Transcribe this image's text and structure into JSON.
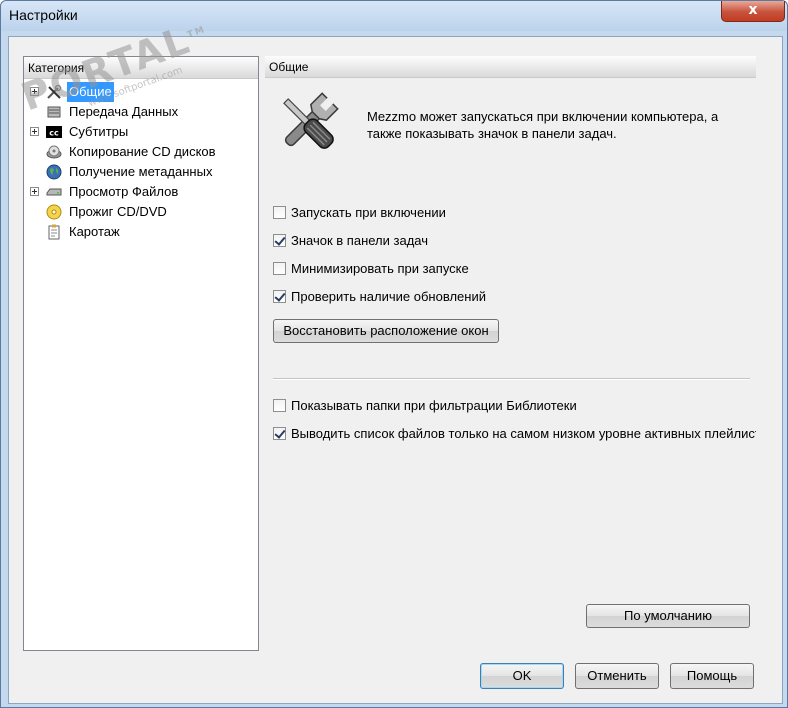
{
  "window": {
    "title": "Настройки",
    "close_glyph": "x"
  },
  "watermark": {
    "big": "PORTAL",
    "tm": "TM",
    "small": "www.softportal.com"
  },
  "category_panel": {
    "header": "Категория",
    "items": [
      {
        "label": "Общие",
        "icon": "tools-icon",
        "expandable": true,
        "selected": true
      },
      {
        "label": "Передача Данных",
        "icon": "server-icon",
        "expandable": false
      },
      {
        "label": "Субтитры",
        "icon": "cc-icon",
        "expandable": true
      },
      {
        "label": "Копирование CD дисков",
        "icon": "cd-drive-icon",
        "expandable": false
      },
      {
        "label": "Получение метаданных",
        "icon": "globe-icon",
        "expandable": false
      },
      {
        "label": "Просмотр Файлов",
        "icon": "drive-icon",
        "expandable": true
      },
      {
        "label": "Прожиг CD/DVD",
        "icon": "disc-icon",
        "expandable": false
      },
      {
        "label": "Каротаж",
        "icon": "log-icon",
        "expandable": false
      }
    ]
  },
  "general_panel": {
    "header": "Общие",
    "icon": "tools-icon",
    "description": "Mezzmo может запускаться при включении компьютера, а также показывать значок в панели задач.",
    "checkboxes": [
      {
        "label": "Запускать при включении",
        "checked": false
      },
      {
        "label": "Значок в панели задач",
        "checked": true
      },
      {
        "label": "Минимизировать при запуске",
        "checked": false
      },
      {
        "label": "Проверить наличие обновлений",
        "checked": true
      }
    ],
    "reset_layout_button": "Восстановить расположение окон",
    "checkboxes2": [
      {
        "label": "Показывать папки при фильтрации Библиотеки",
        "checked": false
      },
      {
        "label": "Выводить список файлов только на самом низком уровне активных плейлисто",
        "checked": true
      }
    ],
    "defaults_button": "По умолчанию"
  },
  "footer": {
    "ok": "OK",
    "cancel": "Отменить",
    "help": "Помощь"
  }
}
